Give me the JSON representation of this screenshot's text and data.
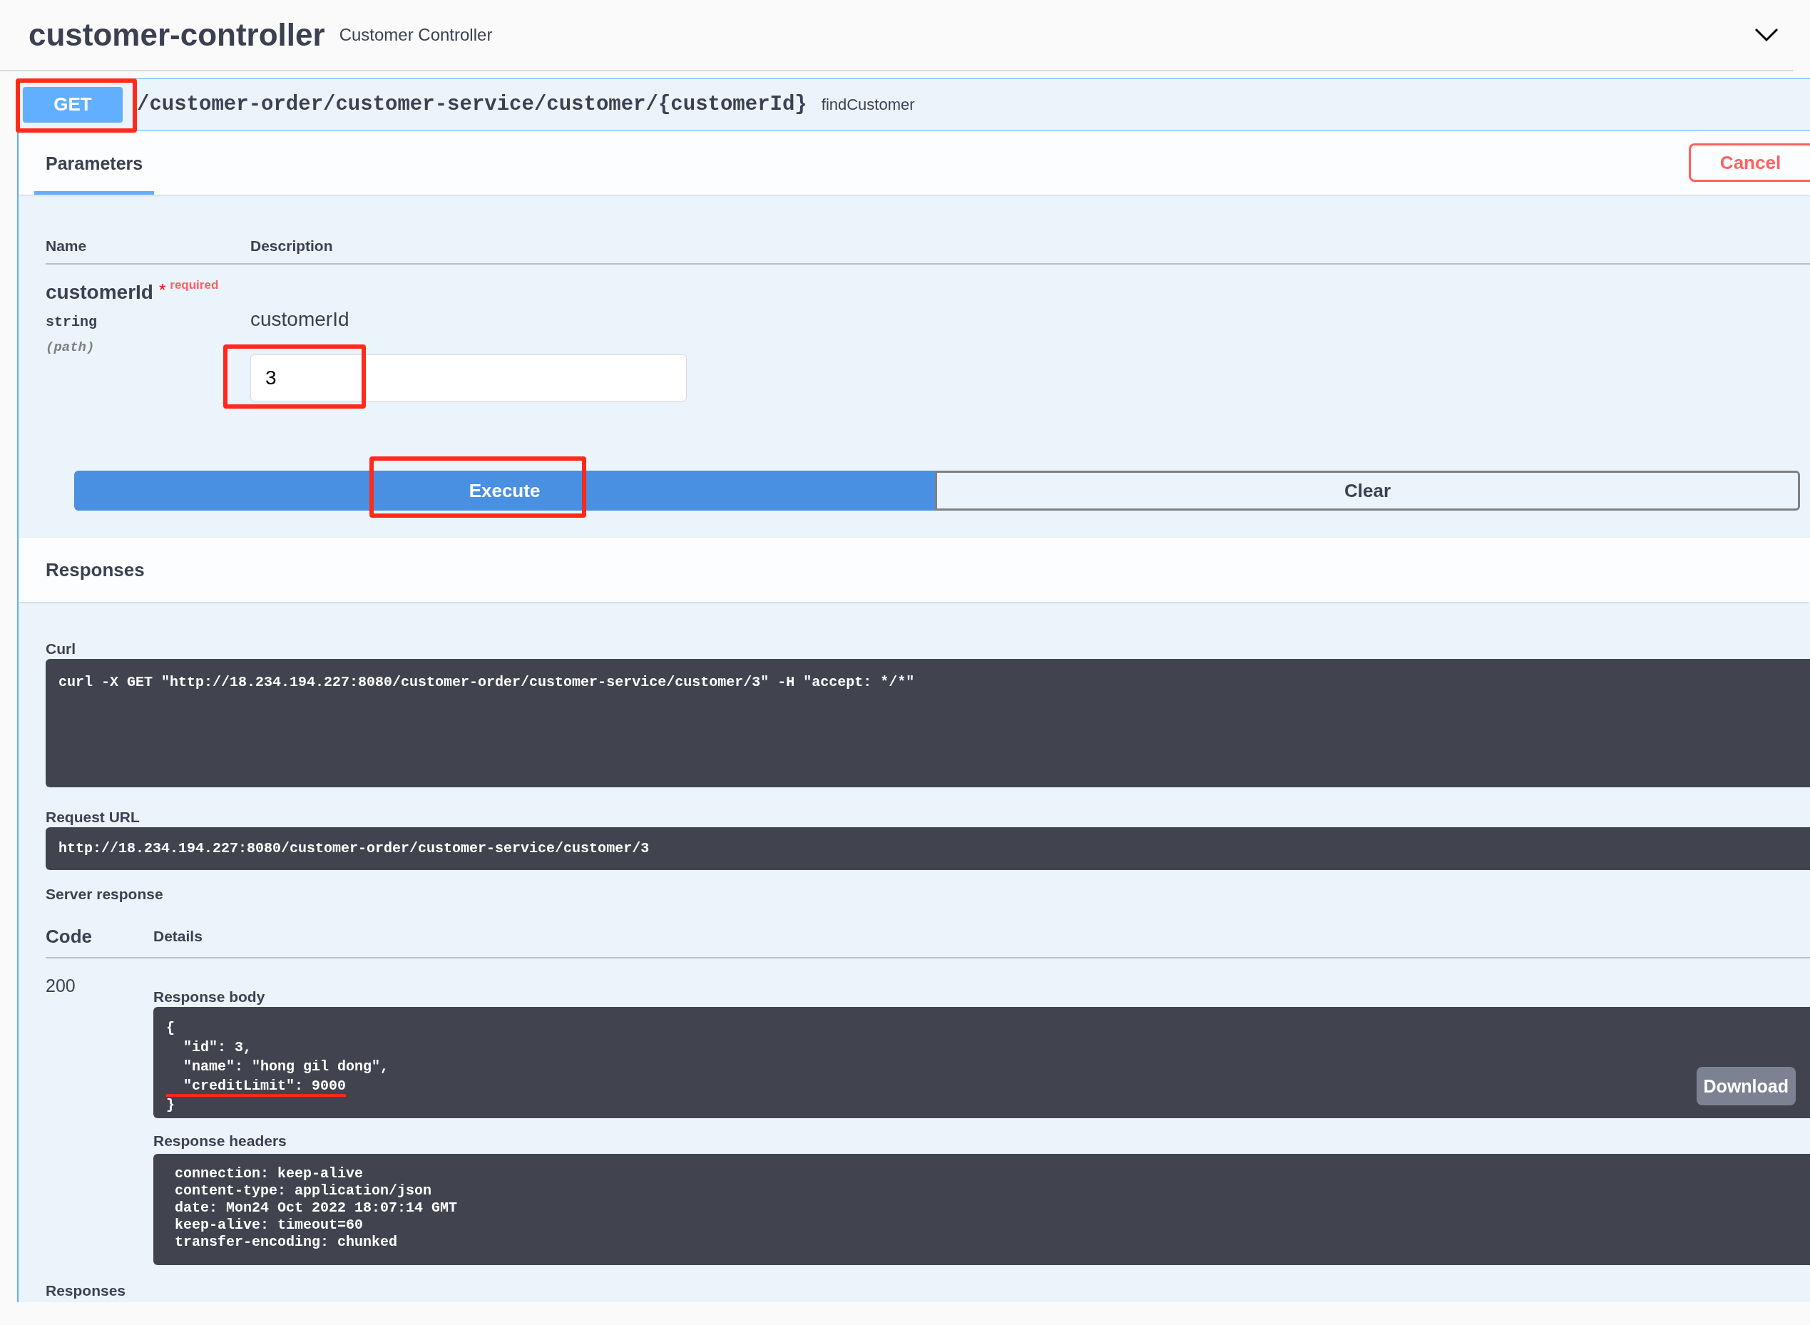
{
  "tag": {
    "name": "customer-controller",
    "description": "Customer Controller",
    "expanded": true
  },
  "operation": {
    "method": "GET",
    "method_annotated": true,
    "path": "/customer-order/customer-service/customer/{customerId}",
    "summary": "findCustomer"
  },
  "tabs": [
    {
      "label": "Parameters",
      "selected": true
    }
  ],
  "cancel_button": "Cancel",
  "parameters": {
    "columns": [
      "Name",
      "Description"
    ],
    "rows": [
      {
        "name": "customerId",
        "required_mark": "*",
        "required_label": "required",
        "type": "string",
        "location": "(path)",
        "description": "customerId",
        "value": "3",
        "value_annotated": true
      }
    ]
  },
  "execute_button": {
    "label": "Execute",
    "annotated": true
  },
  "clear_button": "Clear",
  "responses_heading": "Responses",
  "curl": {
    "label": "Curl",
    "command": "curl -X GET \"http://18.234.194.227:8080/customer-order/customer-service/customer/3\" -H \"accept: */*\""
  },
  "request_url": {
    "label": "Request URL",
    "url": "http://18.234.194.227:8080/customer-order/customer-service/customer/3"
  },
  "server_response": {
    "label": "Server response",
    "columns": [
      "Code",
      "Details"
    ],
    "code": "200",
    "body_label": "Response body",
    "body_lines": [
      {
        "text": "{",
        "underlined": false
      },
      {
        "text": "  \"id\": 3,",
        "underlined": false
      },
      {
        "text": "  \"name\": \"hong gil dong\",",
        "underlined": false
      },
      {
        "text": "  \"creditLimit\": 9000",
        "underlined": true
      },
      {
        "text": "}",
        "underlined": false
      }
    ],
    "download_button": "Download",
    "headers_label": "Response headers",
    "header_lines": [
      "connection: keep-alive",
      "content-type: application/json",
      "date: Mon24 Oct 2022 18:07:14 GMT",
      "keep-alive: timeout=60",
      "transfer-encoding: chunked"
    ]
  },
  "footer_heading": "Responses"
}
